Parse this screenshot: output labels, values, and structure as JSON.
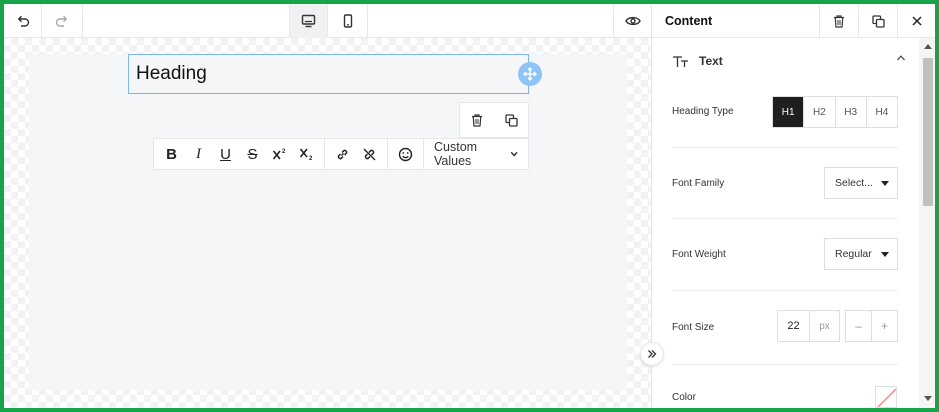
{
  "toolbar": {
    "undo_icon": "undo-icon",
    "redo_icon": "redo-icon",
    "desktop_icon": "desktop-icon",
    "mobile_icon": "mobile-icon",
    "preview_icon": "eye-icon"
  },
  "canvas": {
    "heading_text": "Heading",
    "format_bar": {
      "bold": "B",
      "italic": "I",
      "underline": "U",
      "strike": "S",
      "custom_values_label": "Custom Values"
    }
  },
  "panel": {
    "title": "Content",
    "section_title": "Text",
    "heading_type": {
      "label": "Heading Type",
      "options": [
        "H1",
        "H2",
        "H3",
        "H4"
      ],
      "selected": "H1"
    },
    "font_family": {
      "label": "Font Family",
      "value": "Select..."
    },
    "font_weight": {
      "label": "Font Weight",
      "value": "Regular"
    },
    "font_size": {
      "label": "Font Size",
      "value": "22",
      "unit": "px",
      "decrement": "–",
      "increment": "+"
    },
    "color": {
      "label": "Color"
    }
  },
  "colors": {
    "frame_border": "#16a34a",
    "selection_blue": "#7cb6ea",
    "handle_blue": "#8ec4f5",
    "selected_dark": "#1f1f1f"
  }
}
